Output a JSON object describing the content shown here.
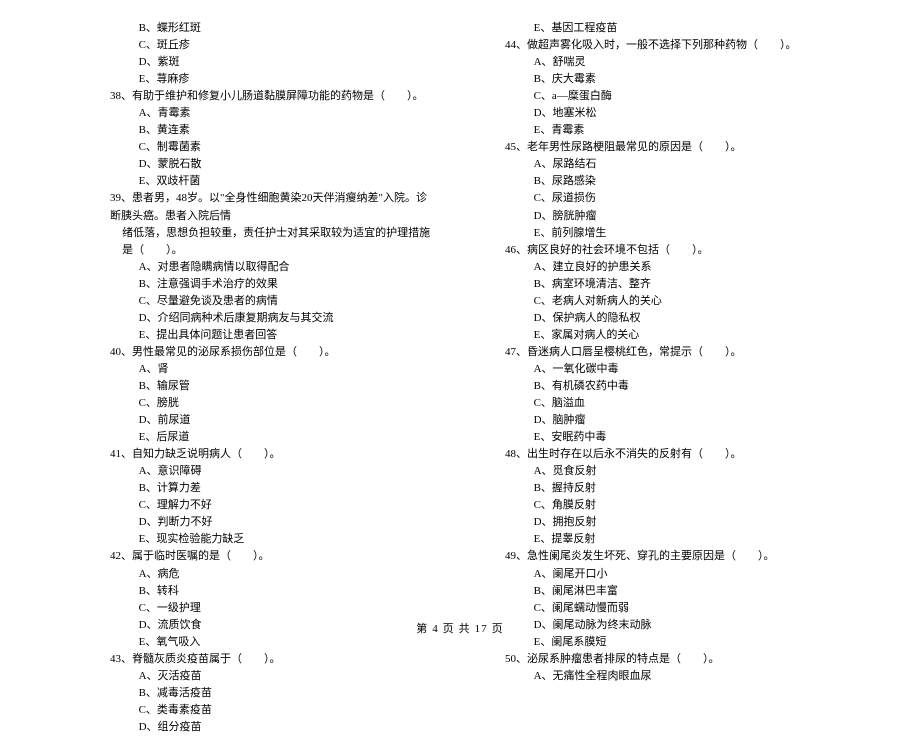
{
  "left": {
    "q37_opts": [
      "B、蝶形红斑",
      "C、斑丘疹",
      "D、紫斑",
      "E、荨麻疹"
    ],
    "q38": "38、有助于维护和修复小儿肠道黏膜屏障功能的药物是（　　）。",
    "q38_opts": [
      "A、青霉素",
      "B、黄连素",
      "C、制霉菌素",
      "D、蒙脱石散",
      "E、双歧杆菌"
    ],
    "q39": "39、患者男，48岁。以\"全身性细胞黄染20天伴消瘦纳差\"入院。诊断胰头癌。患者入院后情",
    "q39_cont": "绪低落，思想负担较重，责任护士对其采取较为适宜的护理措施是（　　）。",
    "q39_opts": [
      "A、对患者隐瞒病情以取得配合",
      "B、注意强调手术治疗的效果",
      "C、尽量避免谈及患者的病情",
      "D、介绍同病种术后康复期病友与其交流",
      "E、提出具体问题让患者回答"
    ],
    "q40": "40、男性最常见的泌尿系损伤部位是（　　）。",
    "q40_opts": [
      "A、肾",
      "B、输尿管",
      "C、膀胱",
      "D、前尿道",
      "E、后尿道"
    ],
    "q41": "41、自知力缺乏说明病人（　　）。",
    "q41_opts": [
      "A、意识障碍",
      "B、计算力差",
      "C、理解力不好",
      "D、判断力不好",
      "E、现实检验能力缺乏"
    ],
    "q42": "42、属于临时医嘱的是（　　）。",
    "q42_opts": [
      "A、病危",
      "B、转科",
      "C、一级护理",
      "D、流质饮食",
      "E、氧气吸入"
    ],
    "q43": "43、脊髓灰质炎疫苗属于（　　）。",
    "q43_opts": [
      "A、灭活疫苗",
      "B、减毒活疫苗",
      "C、类毒素疫苗",
      "D、组分疫苗"
    ]
  },
  "right": {
    "q43_opts_cont": [
      "E、基因工程疫苗"
    ],
    "q44": "44、做超声雾化吸入时，一般不选择下列那种药物（　　）。",
    "q44_opts": [
      "A、舒喘灵",
      "B、庆大霉素",
      "C、a—糜蛋白酶",
      "D、地塞米松",
      "E、青霉素"
    ],
    "q45": "45、老年男性尿路梗阻最常见的原因是（　　）。",
    "q45_opts": [
      "A、尿路结石",
      "B、尿路感染",
      "C、尿道损伤",
      "D、膀胱肿瘤",
      "E、前列腺增生"
    ],
    "q46": "46、病区良好的社会环境不包括（　　）。",
    "q46_opts": [
      "A、建立良好的护患关系",
      "B、病室环境清洁、整齐",
      "C、老病人对新病人的关心",
      "D、保护病人的隐私权",
      "E、家属对病人的关心"
    ],
    "q47": "47、昏迷病人口唇呈樱桃红色，常提示（　　）。",
    "q47_opts": [
      "A、一氧化碳中毒",
      "B、有机磷农药中毒",
      "C、脑溢血",
      "D、脑肿瘤",
      "E、安眠药中毒"
    ],
    "q48": "48、出生时存在以后永不消失的反射有（　　）。",
    "q48_opts": [
      "A、觅食反射",
      "B、握持反射",
      "C、角膜反射",
      "D、拥抱反射",
      "E、提睾反射"
    ],
    "q49": "49、急性阑尾炎发生坏死、穿孔的主要原因是（　　）。",
    "q49_opts": [
      "A、阑尾开口小",
      "B、阑尾淋巴丰富",
      "C、阑尾蠕动慢而弱",
      "D、阑尾动脉为终末动脉",
      "E、阑尾系膜短"
    ],
    "q50": "50、泌尿系肿瘤患者排尿的特点是（　　）。",
    "q50_opts": [
      "A、无痛性全程肉眼血尿"
    ]
  },
  "footer": "第 4 页 共 17 页"
}
